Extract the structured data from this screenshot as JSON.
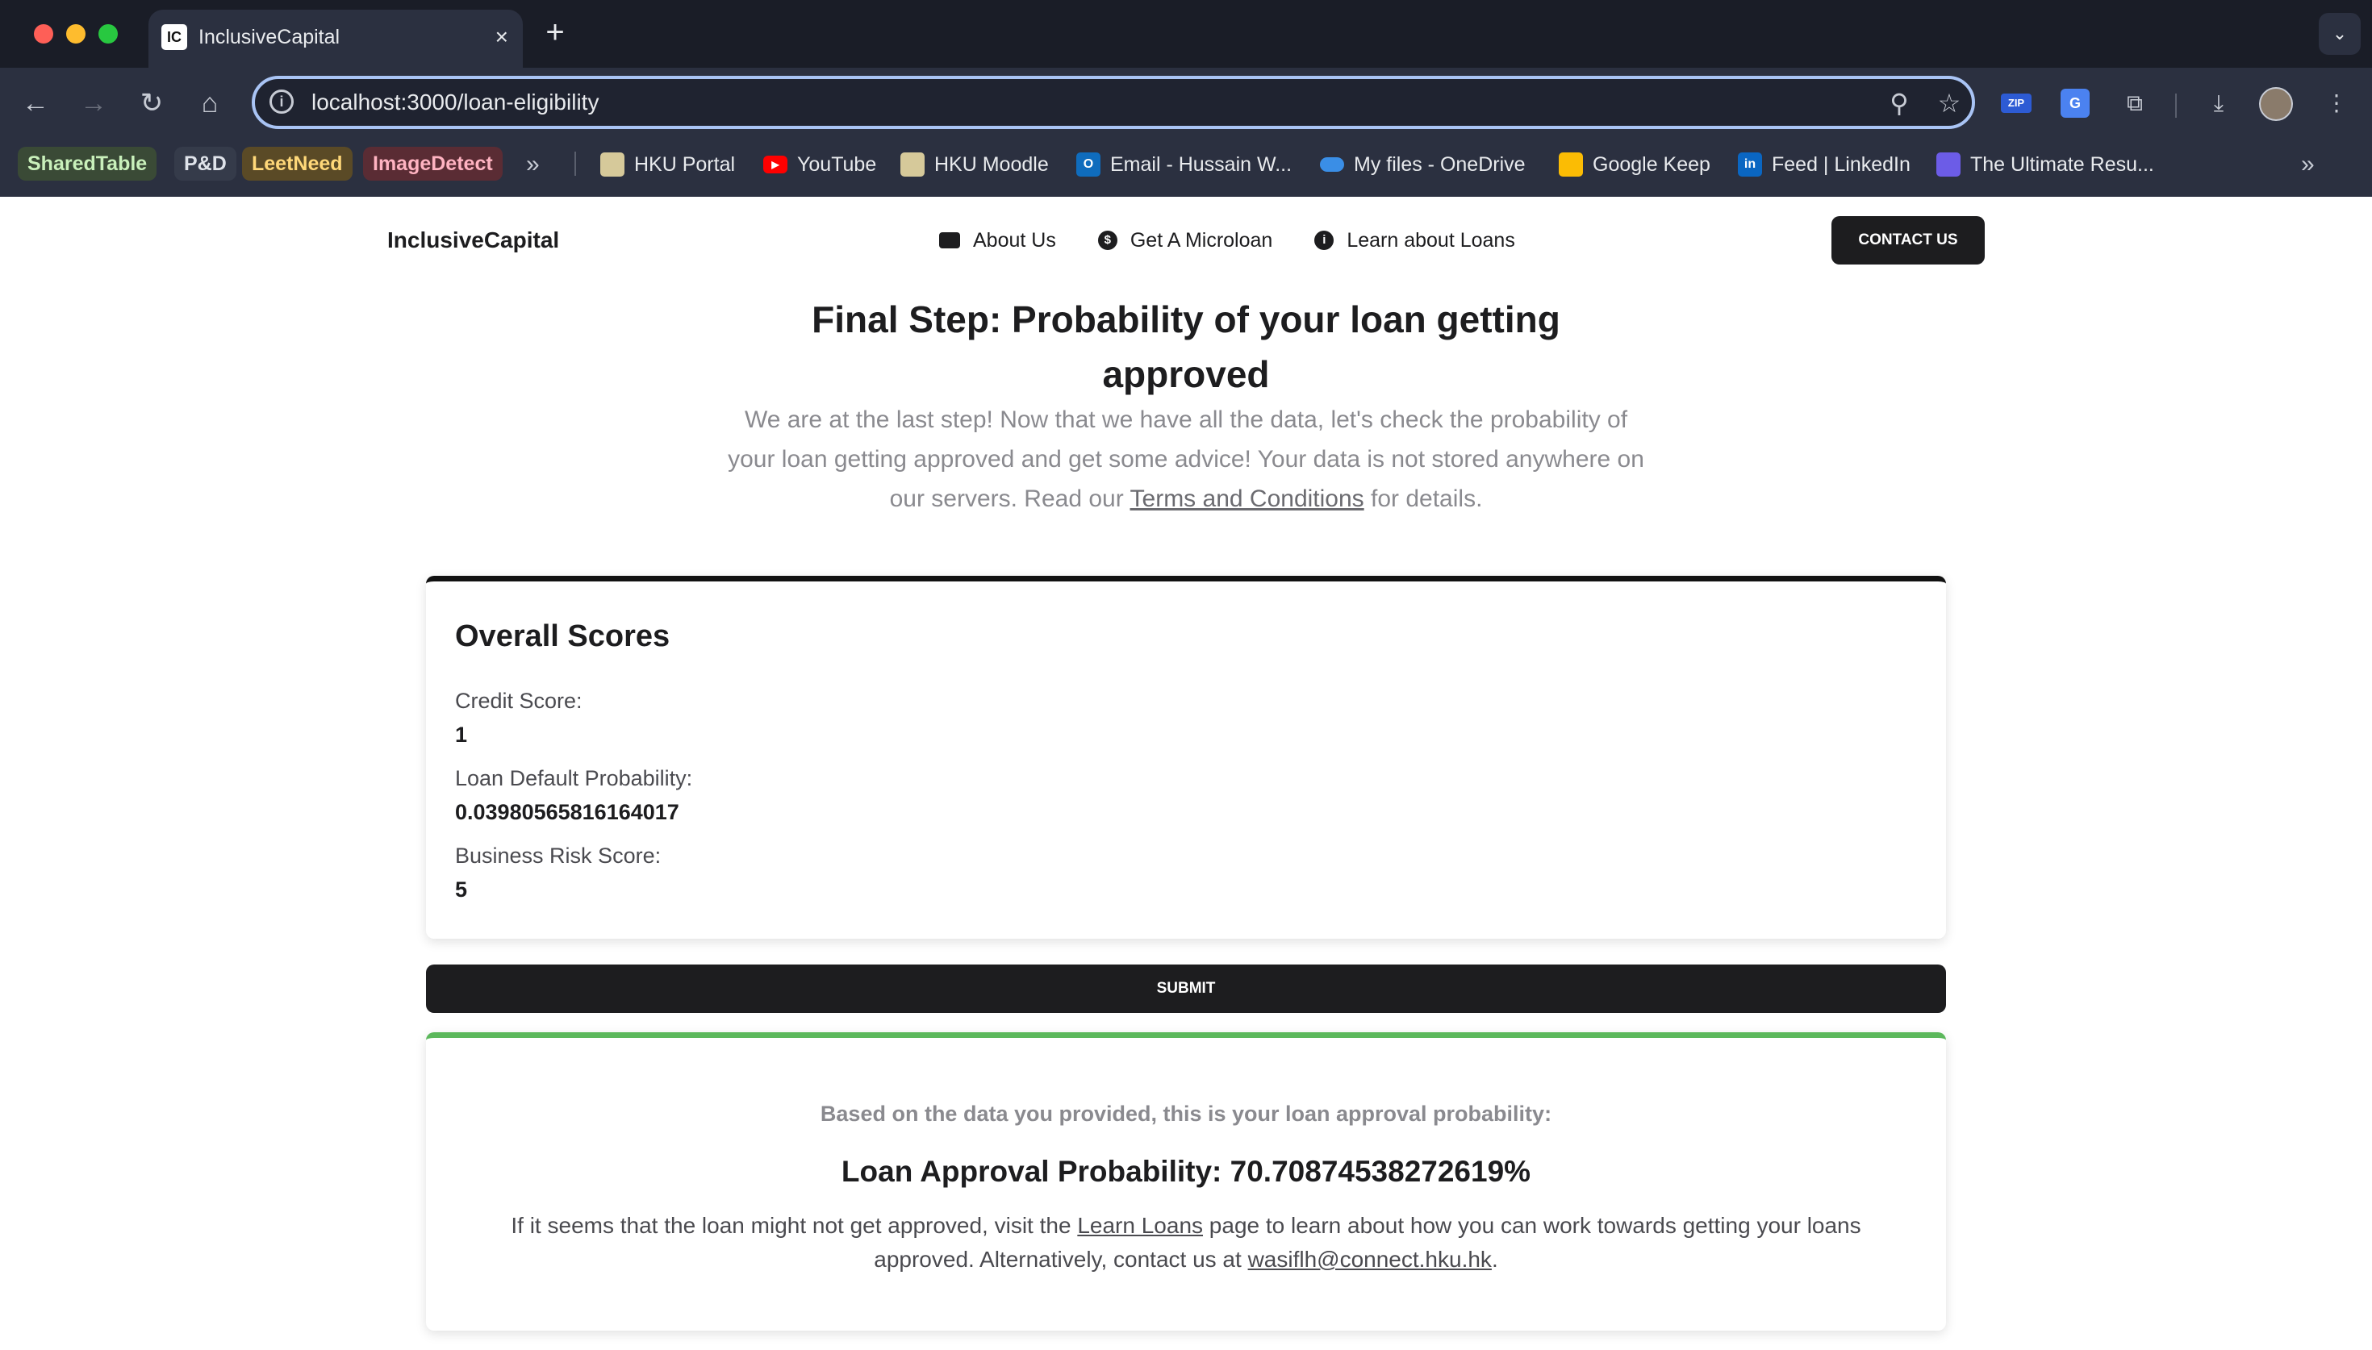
{
  "browser": {
    "tab_title": "InclusiveCapital",
    "tab_favicon": "IC",
    "tab_close_icon": "×",
    "new_tab_icon": "+",
    "tab_menu_icon": "⌄",
    "url": "localhost:3000/loan-eligibility",
    "nav": {
      "back_icon": "←",
      "forward_icon": "→",
      "reload_icon": "↻",
      "home_icon": "⌂"
    },
    "omnibox_icons": {
      "info_icon": "i",
      "zoom_icon": "⚲",
      "star_icon": "☆"
    },
    "extensions": {
      "zip_label": "ZIP",
      "translate_label": "G",
      "puzzle_icon": "⧉",
      "download_icon": "⤓",
      "menu_icon": "⋮"
    },
    "bookmark_chips": [
      "SharedTable",
      "P&D",
      "LeetNeed",
      "ImageDetect"
    ],
    "bookmarks_overflow_icon": "»",
    "bookmarks": [
      {
        "label": "HKU Portal",
        "icon": "hku-portal-icon"
      },
      {
        "label": "YouTube",
        "icon": "youtube-icon"
      },
      {
        "label": "HKU Moodle",
        "icon": "hku-moodle-icon"
      },
      {
        "label": "Email - Hussain W...",
        "icon": "outlook-icon"
      },
      {
        "label": "My files - OneDrive",
        "icon": "onedrive-icon"
      },
      {
        "label": "Google Keep",
        "icon": "google-keep-icon"
      },
      {
        "label": "Feed | LinkedIn",
        "icon": "linkedin-icon"
      },
      {
        "label": "The Ultimate Resu...",
        "icon": "resume-icon"
      }
    ]
  },
  "site": {
    "logo": "InclusiveCapital",
    "nav": [
      {
        "label": "About Us",
        "icon": "briefcase-icon"
      },
      {
        "label": "Get A Microloan",
        "icon": "dollar-icon"
      },
      {
        "label": "Learn about Loans",
        "icon": "info-icon"
      }
    ],
    "contact_button": "CONTACT US"
  },
  "hero": {
    "title": "Final Step: Probability of your loan getting approved",
    "desc_before": "We are at the last step! Now that we have all the data, let's check the probability of your loan getting approved and get some advice! Your data is not stored anywhere on our servers. Read our ",
    "desc_link": "Terms and Conditions",
    "desc_after": " for details."
  },
  "scores": {
    "title": "Overall Scores",
    "items": [
      {
        "label": "Credit Score:",
        "value": "1"
      },
      {
        "label": "Loan Default Probability:",
        "value": "0.03980565816164017"
      },
      {
        "label": "Business Risk Score:",
        "value": "5"
      }
    ]
  },
  "submit_label": "SUBMIT",
  "result": {
    "intro": "Based on the data you provided, this is your loan approval probability:",
    "probability": "Loan Approval Probability: 70.70874538272619%",
    "advice_before": "If it seems that the loan might not get approved, visit the ",
    "advice_link": "Learn Loans",
    "advice_middle": " page to learn about how you can work towards getting your loans approved. Alternatively, contact us at ",
    "advice_email": "wasiflh@connect.hku.hk",
    "advice_after": "."
  },
  "colors": {
    "accent_dark": "#1d1d1f",
    "result_accent": "#5cb85c",
    "chrome_bg": "#2b3040"
  }
}
